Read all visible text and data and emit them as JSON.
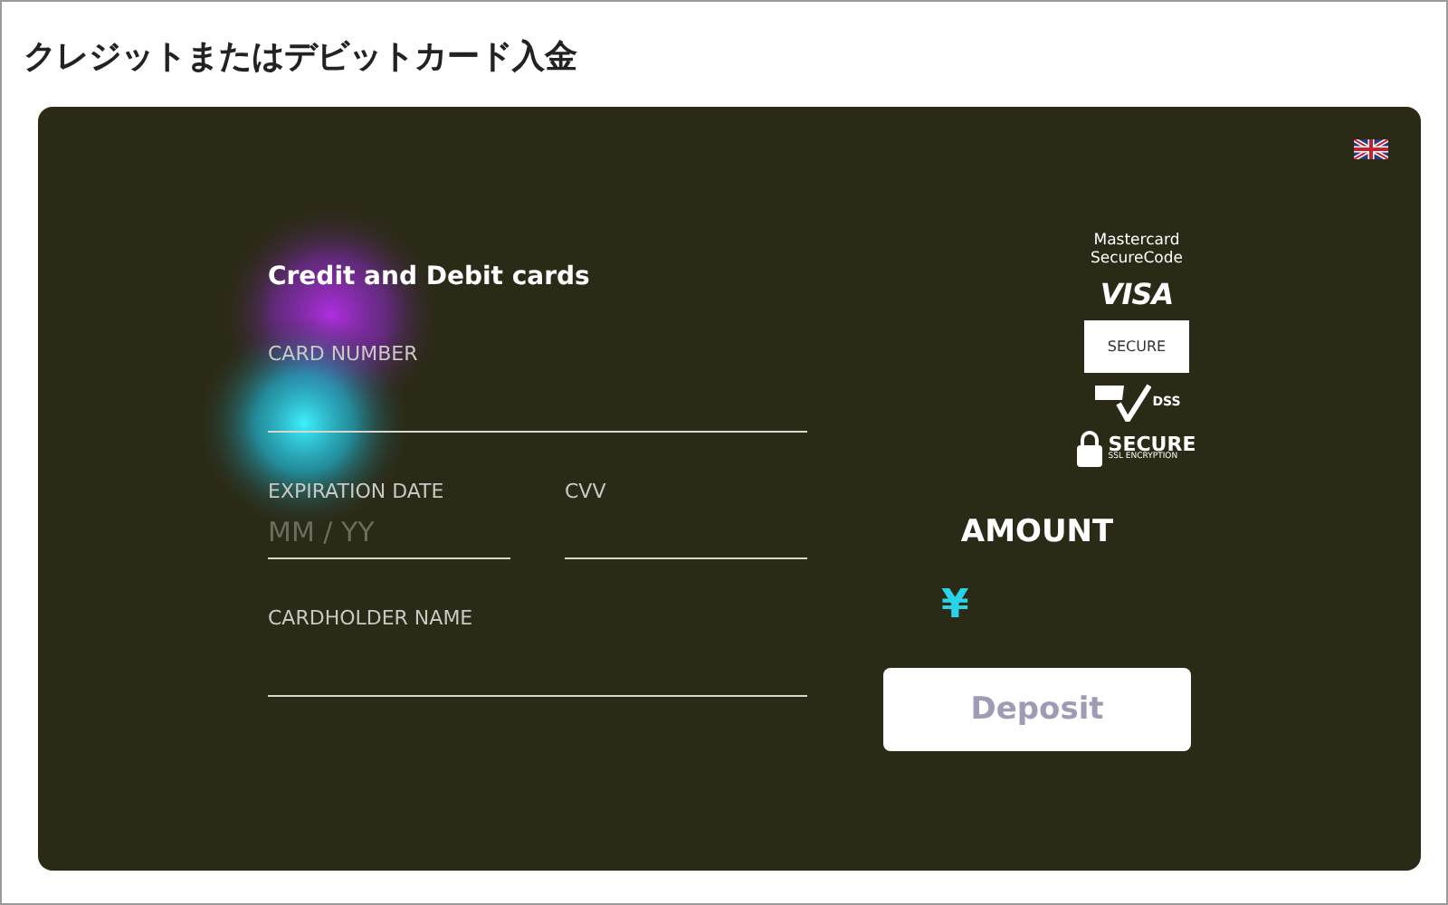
{
  "page_title": "クレジットまたはデビットカード入金",
  "form": {
    "title": "Credit and Debit cards",
    "field_rows": [
      [
        {
          "label": "CARD NUMBER"
        }
      ],
      [
        {
          "label": "EXPIRATION DATE",
          "placeholder": "MM / YY"
        },
        {
          "label": "CVV"
        }
      ],
      [
        {
          "label": "CARDHOLDER NAME"
        }
      ]
    ]
  },
  "badges": [
    {
      "kind": "text",
      "lines": [
        "Mastercard",
        "SecureCode"
      ]
    },
    {
      "kind": "visa",
      "lines": [
        "VISA"
      ]
    },
    {
      "kind": "boxed",
      "lines": [
        "SECURE"
      ]
    },
    {
      "kind": "pci",
      "lines": [
        "DSS"
      ]
    },
    {
      "kind": "ssl",
      "lines": [
        "SECURE",
        "SSL ENCRYPTION"
      ]
    }
  ],
  "amount": {
    "label": "AMOUNT",
    "currency": "¥"
  },
  "deposit_button": {
    "label": "Deposit",
    "disabled": true
  }
}
